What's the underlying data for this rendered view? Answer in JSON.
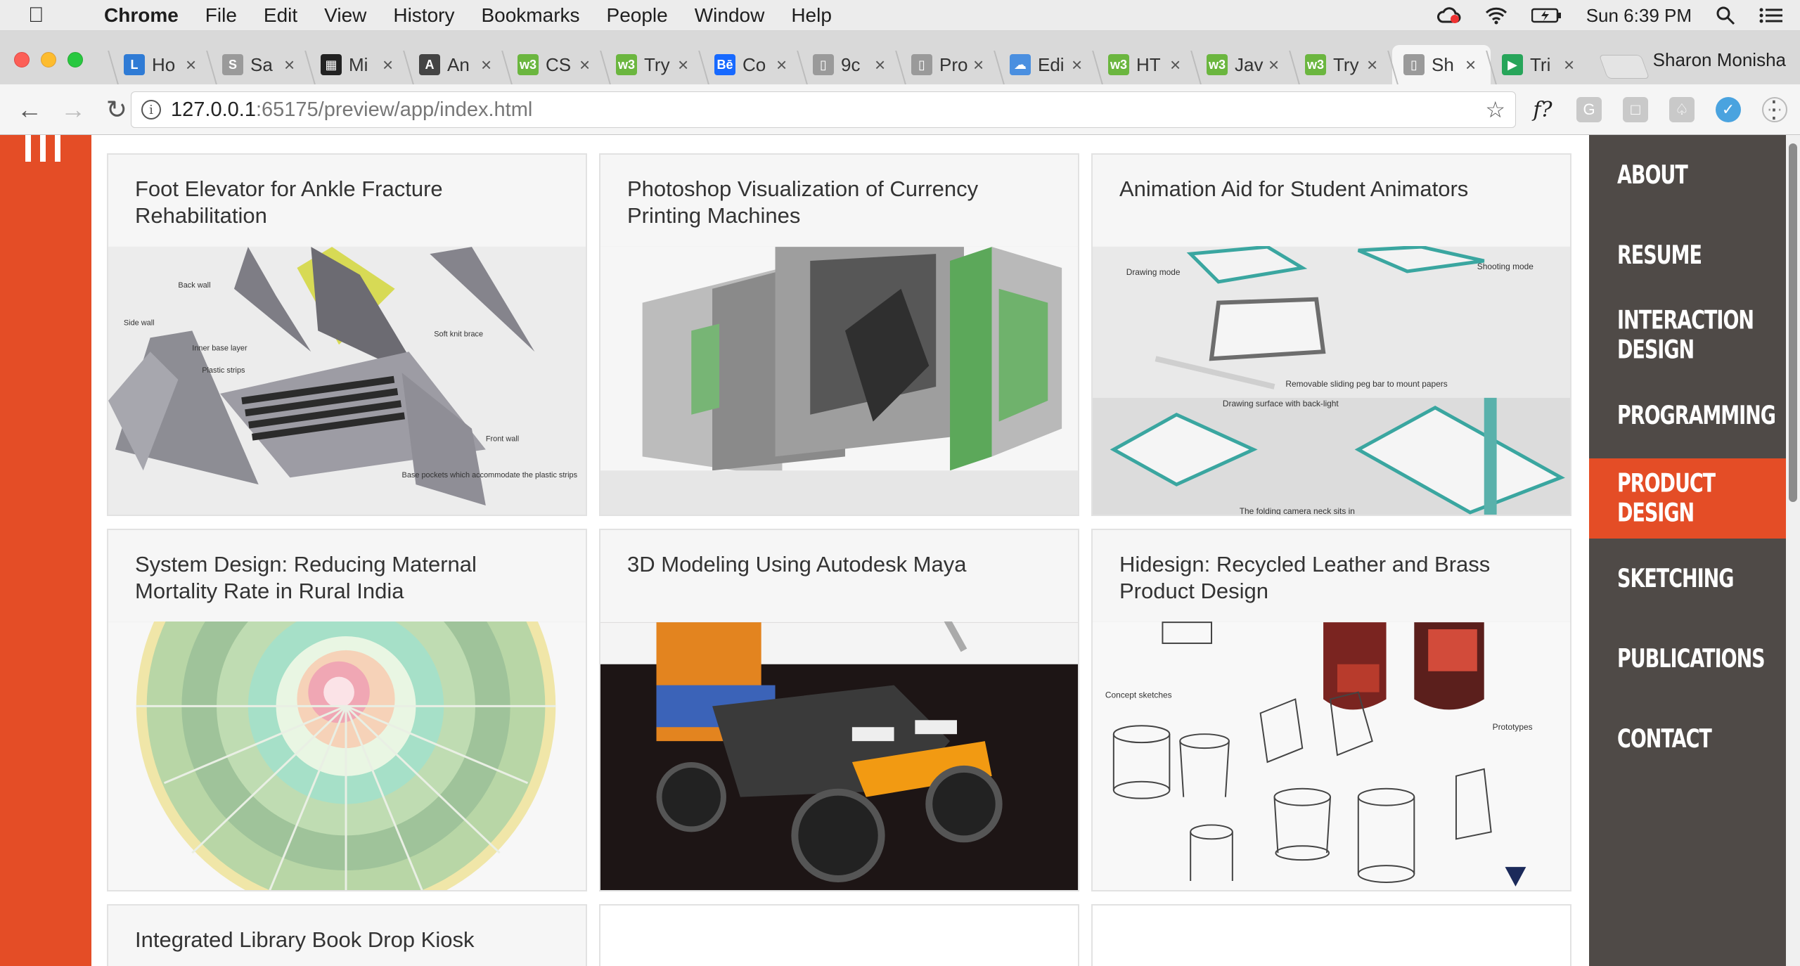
{
  "menubar": {
    "app": "Chrome",
    "items": [
      "File",
      "Edit",
      "View",
      "History",
      "Bookmarks",
      "People",
      "Window",
      "Help"
    ],
    "clock": "Sun 6:39 PM"
  },
  "tabs": [
    {
      "label": "Ho",
      "color": "#2f7bd5",
      "glyph": "L"
    },
    {
      "label": "Sa",
      "color": "#9a9a9a",
      "glyph": "S"
    },
    {
      "label": "Mi",
      "color": "#222222",
      "glyph": "▦"
    },
    {
      "label": "An",
      "color": "#444444",
      "glyph": "A"
    },
    {
      "label": "CS",
      "color": "#6bb63f",
      "glyph": "w3"
    },
    {
      "label": "Try",
      "color": "#6bb63f",
      "glyph": "w3"
    },
    {
      "label": "Co",
      "color": "#1769ff",
      "glyph": "Bē"
    },
    {
      "label": "9c",
      "color": "#9a9a9a",
      "glyph": "▯"
    },
    {
      "label": "Pro",
      "color": "#9a9a9a",
      "glyph": "▯"
    },
    {
      "label": "Edi",
      "color": "#4a8fe0",
      "glyph": "☁"
    },
    {
      "label": "HT",
      "color": "#6bb63f",
      "glyph": "w3"
    },
    {
      "label": "Jav",
      "color": "#6bb63f",
      "glyph": "w3"
    },
    {
      "label": "Try",
      "color": "#6bb63f",
      "glyph": "w3"
    },
    {
      "label": "Sh",
      "color": "#9a9a9a",
      "glyph": "▯"
    },
    {
      "label": "Tri",
      "color": "#27a55a",
      "glyph": "▶"
    }
  ],
  "profile": "Sharon Monisha",
  "address": {
    "host": "127.0.0.1",
    "rest": ":65175/preview/app/index.html"
  },
  "cards": [
    {
      "title": "Foot Elevator for Ankle Fracture Rehabilitation"
    },
    {
      "title": "Photoshop Visualization of Currency Printing Machines"
    },
    {
      "title": "Animation Aid for Student Animators"
    },
    {
      "title": "System Design: Reducing Maternal Mortality Rate in Rural India"
    },
    {
      "title": "3D Modeling Using Autodesk Maya"
    },
    {
      "title": "Hidesign: Recycled Leather and Brass Product Design"
    },
    {
      "title": "Integrated Library Book Drop Kiosk"
    },
    {
      "title": ""
    },
    {
      "title": ""
    }
  ],
  "card_art_labels": {
    "foot": [
      "Back wall",
      "Side wall",
      "Inner base layer",
      "Plastic strips",
      "Soft knit brace",
      "Front wall",
      "Base pockets which accommodate the plastic strips"
    ],
    "anim": [
      "Drawing mode",
      "Shooting mode",
      "Removable sliding peg bar to mount papers",
      "Drawing surface with back-light",
      "The folding camera neck sits in"
    ],
    "hide": [
      "Concept sketches",
      "Prototypes"
    ]
  },
  "nav": [
    {
      "label": "About",
      "active": false
    },
    {
      "label": "Resume",
      "active": false
    },
    {
      "label": "Interaction Design",
      "active": false
    },
    {
      "label": "Programming",
      "active": false
    },
    {
      "label": "Product Design",
      "active": true
    },
    {
      "label": "Sketching",
      "active": false
    },
    {
      "label": "Publications",
      "active": false
    },
    {
      "label": "Contact",
      "active": false
    }
  ],
  "colors": {
    "accent": "#e44d26",
    "nav_bg": "#4f4a47"
  }
}
